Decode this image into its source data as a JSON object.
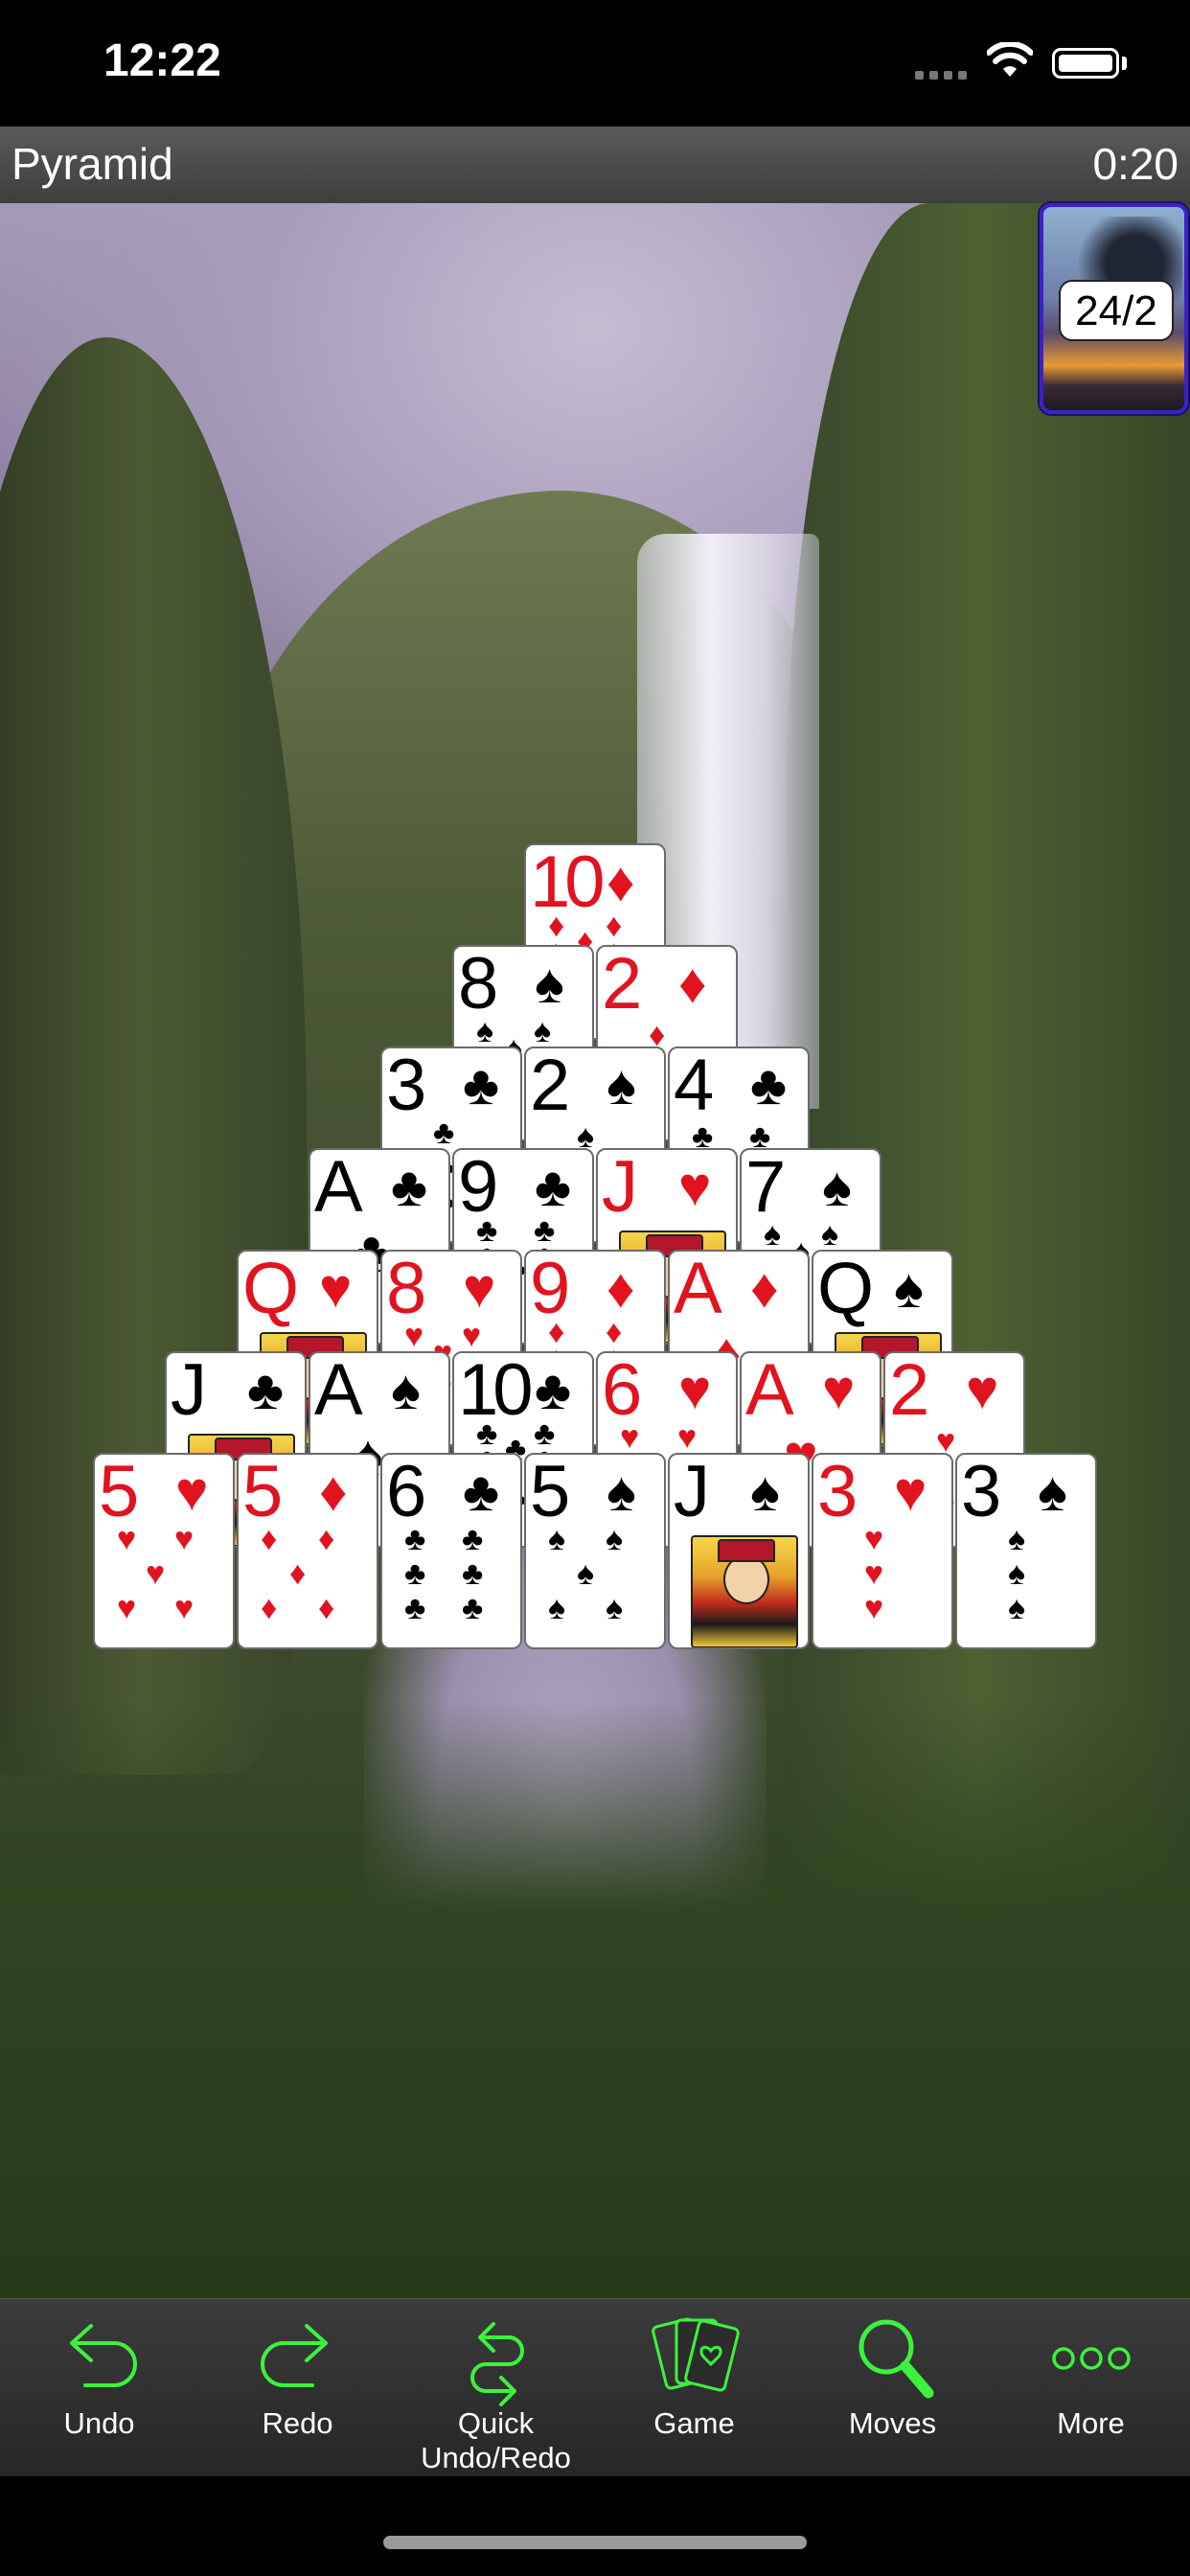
{
  "status_bar": {
    "time": "12:22"
  },
  "header": {
    "game_name": "Pyramid",
    "timer": "0:20"
  },
  "stock": {
    "count": "24/2"
  },
  "pyramid": {
    "rows": [
      [
        {
          "rank": "10",
          "suit": "♦",
          "color": "red"
        }
      ],
      [
        {
          "rank": "8",
          "suit": "♠",
          "color": "black"
        },
        {
          "rank": "2",
          "suit": "♦",
          "color": "red"
        }
      ],
      [
        {
          "rank": "3",
          "suit": "♣",
          "color": "black"
        },
        {
          "rank": "2",
          "suit": "♠",
          "color": "black"
        },
        {
          "rank": "4",
          "suit": "♣",
          "color": "black"
        }
      ],
      [
        {
          "rank": "A",
          "suit": "♣",
          "color": "black"
        },
        {
          "rank": "9",
          "suit": "♣",
          "color": "black"
        },
        {
          "rank": "J",
          "suit": "♥",
          "color": "red"
        },
        {
          "rank": "7",
          "suit": "♠",
          "color": "black"
        }
      ],
      [
        {
          "rank": "Q",
          "suit": "♥",
          "color": "red"
        },
        {
          "rank": "8",
          "suit": "♥",
          "color": "red"
        },
        {
          "rank": "9",
          "suit": "♦",
          "color": "red"
        },
        {
          "rank": "A",
          "suit": "♦",
          "color": "red"
        },
        {
          "rank": "Q",
          "suit": "♠",
          "color": "black"
        }
      ],
      [
        {
          "rank": "J",
          "suit": "♣",
          "color": "black"
        },
        {
          "rank": "A",
          "suit": "♠",
          "color": "black"
        },
        {
          "rank": "10",
          "suit": "♣",
          "color": "black"
        },
        {
          "rank": "6",
          "suit": "♥",
          "color": "red"
        },
        {
          "rank": "A",
          "suit": "♥",
          "color": "red"
        },
        {
          "rank": "2",
          "suit": "♥",
          "color": "red"
        }
      ],
      [
        {
          "rank": "5",
          "suit": "♥",
          "color": "red"
        },
        {
          "rank": "5",
          "suit": "♦",
          "color": "red"
        },
        {
          "rank": "6",
          "suit": "♣",
          "color": "black"
        },
        {
          "rank": "5",
          "suit": "♠",
          "color": "black"
        },
        {
          "rank": "J",
          "suit": "♠",
          "color": "black"
        },
        {
          "rank": "3",
          "suit": "♥",
          "color": "red"
        },
        {
          "rank": "3",
          "suit": "♠",
          "color": "black"
        }
      ]
    ]
  },
  "toolbar": {
    "accent_color": "#3df23d",
    "items": [
      {
        "label": "Undo",
        "icon": "undo-arrow-icon"
      },
      {
        "label": "Redo",
        "icon": "redo-arrow-icon"
      },
      {
        "label": "Quick Undo/Redo",
        "icon": "quick-undo-redo-icon"
      },
      {
        "label": "Game",
        "icon": "playing-cards-icon"
      },
      {
        "label": "Moves",
        "icon": "magnifier-icon"
      },
      {
        "label": "More",
        "icon": "more-dots-icon"
      }
    ]
  }
}
